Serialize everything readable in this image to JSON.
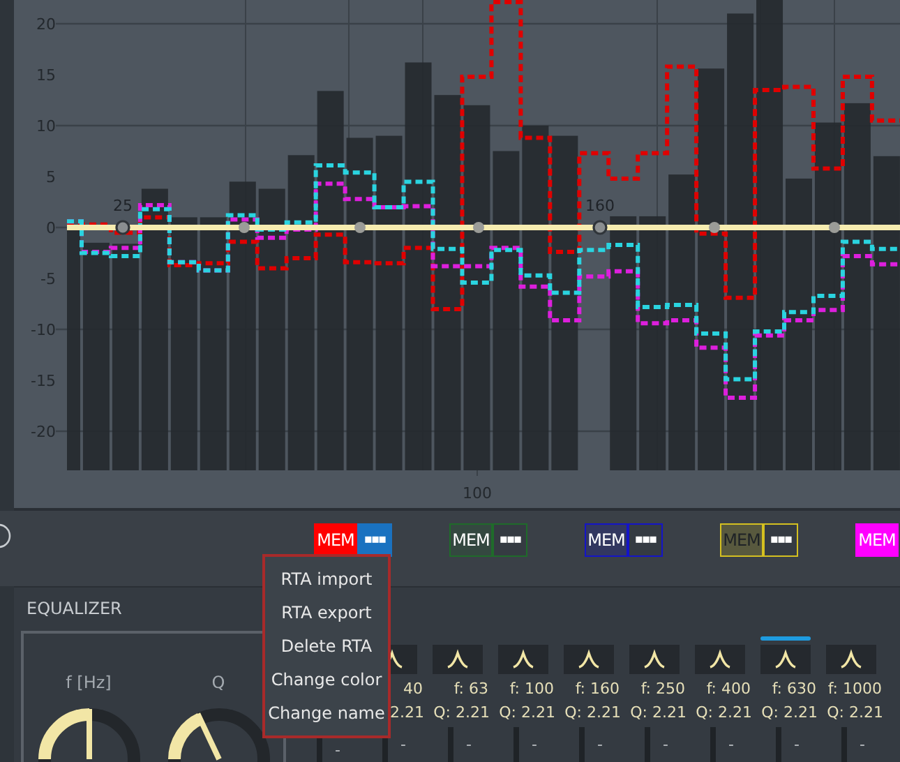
{
  "chart": {
    "y_labels": [
      "20",
      "15",
      "10",
      "5",
      "0",
      "-5",
      "-10",
      "-15",
      "-20"
    ],
    "x_labels": [
      "100"
    ],
    "nodes": [
      {
        "label": "25",
        "selected": true
      },
      {
        "selected": false
      },
      {
        "selected": false
      },
      {
        "selected": false
      },
      {
        "label": "160",
        "selected": true
      },
      {
        "selected": false
      },
      {
        "selected": false
      }
    ]
  },
  "memories": [
    {
      "label": "MEM",
      "more": "▪▪▪",
      "color": "#ff0000",
      "filled": true,
      "dimmed": false,
      "menu_open": true
    },
    {
      "label": "MEM",
      "more": "▪▪▪",
      "color": "#1f6b2a",
      "filled": false,
      "dimmed": false,
      "menu_open": false
    },
    {
      "label": "MEM",
      "more": "▪▪▪",
      "color": "#1414c8",
      "filled": false,
      "dimmed": false,
      "menu_open": false
    },
    {
      "label": "MEM",
      "more": "▪▪▪",
      "color": "#d4c020",
      "filled": false,
      "dimmed": true,
      "menu_open": false
    },
    {
      "label": "MEM",
      "color": "#ff00ff",
      "filled": true,
      "dimmed": false
    }
  ],
  "context_menu": {
    "items": [
      "RTA import",
      "RTA export",
      "Delete RTA",
      "Change color",
      "Change name"
    ]
  },
  "equalizer": {
    "title": "EQUALIZER",
    "knobs": [
      {
        "label": "f [Hz]",
        "level": 0.5
      },
      {
        "label": "Q",
        "level": 0.36
      }
    ],
    "bands": [
      {
        "value": "-",
        "selected": false
      },
      {
        "f": "40",
        "q": "2.21",
        "value": "-",
        "selected": false
      },
      {
        "f": "f: 63",
        "q": "Q: 2.21",
        "value": "-",
        "selected": false
      },
      {
        "f": "f: 100",
        "q": "Q: 2.21",
        "value": "-",
        "selected": false
      },
      {
        "f": "f: 160",
        "q": "Q: 2.21",
        "value": "-",
        "selected": false
      },
      {
        "f": "f: 250",
        "q": "Q: 2.21",
        "value": "-",
        "selected": false
      },
      {
        "f": "f: 400",
        "q": "Q: 2.21",
        "value": "-",
        "selected": false
      },
      {
        "f": "f: 630",
        "q": "Q: 2.21",
        "value": "-",
        "selected": true
      },
      {
        "f": "f: 1000",
        "q": "Q: 2.21",
        "value": "-",
        "selected": false
      }
    ]
  }
}
